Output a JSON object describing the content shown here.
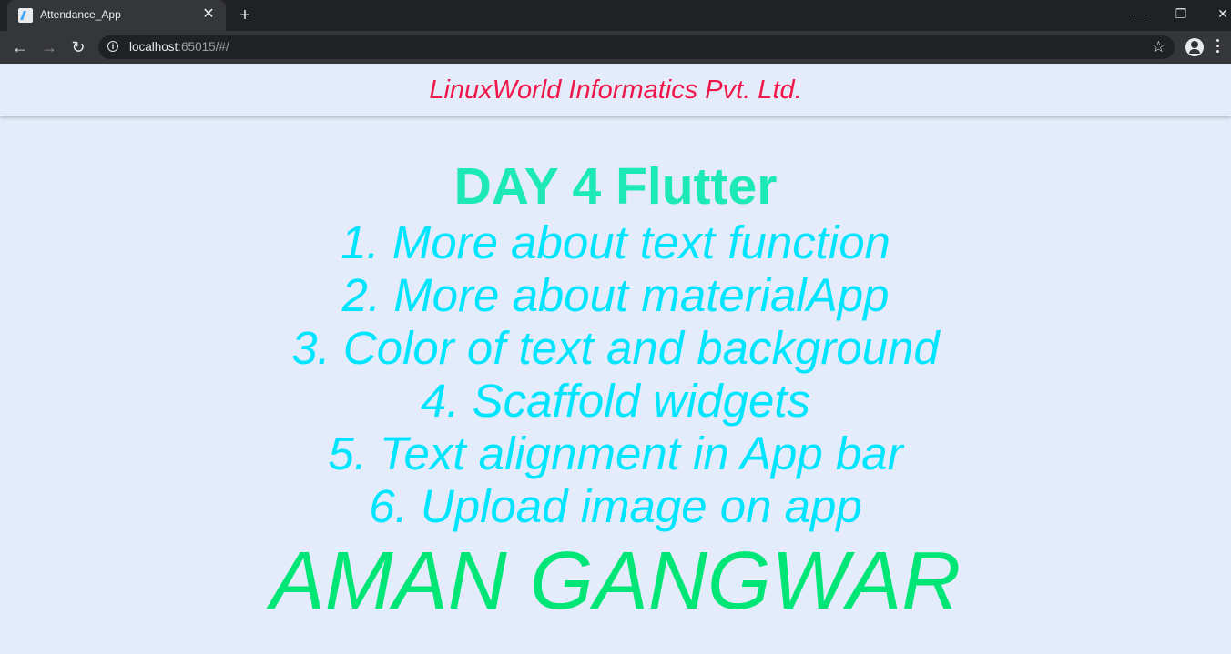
{
  "browser": {
    "tab_title": "Attendance_App",
    "url_host": "localhost",
    "url_rest": ":65015/#/"
  },
  "app": {
    "appbar_title": "LinuxWorld Informatics Pvt. Ltd.",
    "heading": "DAY 4 Flutter",
    "topics": [
      "1. More about text function",
      "2. More about materialApp",
      "3. Color of text and background",
      "4. Scaffold widgets",
      "5. Text alignment in App bar",
      "6. Upload image on app"
    ],
    "author": "AMAN GANGWAR"
  },
  "colors": {
    "appbar_title": "#f0174a",
    "heading": "#1de9b6",
    "topics": "#00e5ff",
    "author": "#00e676",
    "background": "#e4ecfb"
  },
  "icons": [
    "flutter-favicon-icon",
    "close-icon",
    "plus-icon",
    "minimize-icon",
    "restore-icon",
    "window-close-icon",
    "back-arrow-icon",
    "forward-arrow-icon",
    "reload-icon",
    "info-icon",
    "star-icon",
    "profile-icon",
    "kebab-menu-icon"
  ]
}
